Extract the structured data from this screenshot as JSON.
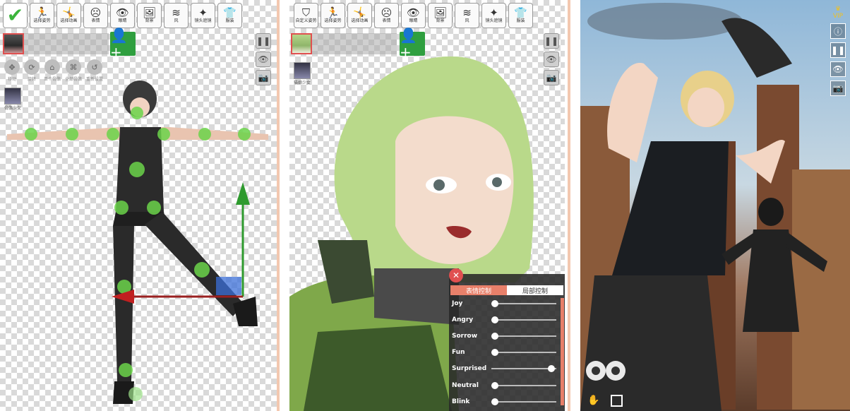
{
  "panel1": {
    "toolbar": [
      {
        "icon": "running-figure-icon",
        "label": "选择姿势"
      },
      {
        "icon": "dance-figure-icon",
        "label": "选择动画"
      },
      {
        "icon": "face-icon",
        "label": "表情"
      },
      {
        "icon": "eye-icon",
        "label": "眼睛"
      },
      {
        "icon": "picture-icon",
        "label": "背景"
      },
      {
        "icon": "wind-icon",
        "label": "风"
      },
      {
        "icon": "magic-wand-icon",
        "label": "镜头遮镜"
      },
      {
        "icon": "shirt-icon",
        "label": "服装"
      }
    ],
    "gizmo_tools": [
      {
        "icon": "move-icon",
        "label": "移动"
      },
      {
        "icon": "rotate-icon",
        "label": "旋转"
      },
      {
        "icon": "single-joint-icon",
        "label": "单个骨骼"
      },
      {
        "icon": "all-joints-icon",
        "label": "全部骨骼"
      },
      {
        "icon": "reset-icon",
        "label": "重新设置"
      }
    ],
    "character_label": "骨骼少女"
  },
  "panel2": {
    "toolbar": [
      {
        "icon": "custom-pose-icon",
        "label": "自定义姿势"
      },
      {
        "icon": "running-figure-icon",
        "label": "选择姿势"
      },
      {
        "icon": "dance-figure-icon",
        "label": "选择动画"
      },
      {
        "icon": "face-icon",
        "label": "表情"
      },
      {
        "icon": "eye-icon",
        "label": "眼睛"
      },
      {
        "icon": "picture-icon",
        "label": "背景"
      },
      {
        "icon": "wind-icon",
        "label": "风"
      },
      {
        "icon": "magic-wand-icon",
        "label": "镜头遮镜"
      },
      {
        "icon": "shirt-icon",
        "label": "服装"
      }
    ],
    "character_label": "猫娘少女",
    "expression_panel": {
      "tab_active": "表情控制",
      "tab_inactive": "局部控制",
      "sliders": [
        {
          "name": "Joy",
          "value": 0.0
        },
        {
          "name": "Angry",
          "value": 0.0
        },
        {
          "name": "Sorrow",
          "value": 0.0
        },
        {
          "name": "Fun",
          "value": 0.0
        },
        {
          "name": "Surprised",
          "value": 0.97
        },
        {
          "name": "Neutral",
          "value": 0.0
        },
        {
          "name": "Blink",
          "value": 0.0
        }
      ]
    }
  },
  "panel3": {
    "vip_label": "VIP"
  }
}
